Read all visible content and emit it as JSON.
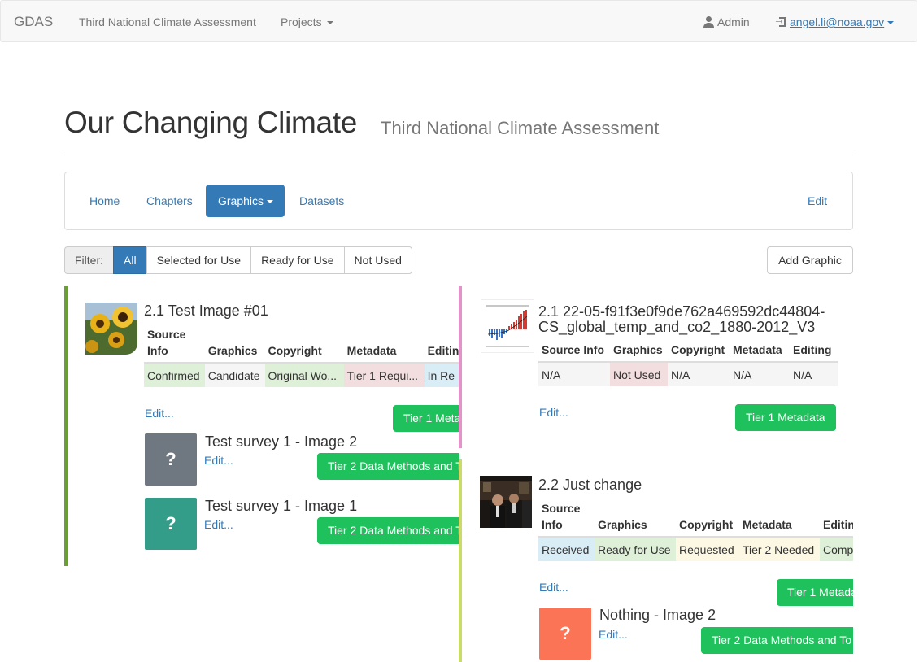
{
  "navbar": {
    "brand": "GDAS",
    "assessment": "Third National Climate Assessment",
    "projects": "Projects",
    "admin": "Admin",
    "user": "angel.li@noaa.gov"
  },
  "header": {
    "title": "Our Changing Climate",
    "subtitle": "Third National Climate Assessment"
  },
  "tabs": {
    "home": "Home",
    "chapters": "Chapters",
    "graphics": "Graphics",
    "datasets": "Datasets",
    "edit": "Edit"
  },
  "filter": {
    "label": "Filter:",
    "all": "All",
    "selected": "Selected for Use",
    "ready": "Ready for Use",
    "not_used": "Not Used",
    "add": "Add Graphic"
  },
  "columns": {
    "source_info": "Source Info",
    "graphics": "Graphics",
    "copyright": "Copyright",
    "metadata": "Metadata",
    "editing": "Editing"
  },
  "cards": [
    {
      "title": "2.1 Test Image #01",
      "values": [
        "Confirmed",
        "Candidate",
        "Original Wo...",
        "Tier 1 Requi...",
        "In Re"
      ],
      "edit": "Edit...",
      "button": "Tier 1 Meta",
      "bar_color": "#6b9e34",
      "children": [
        {
          "title": "Test survey 1 - Image 2",
          "edit": "Edit...",
          "button": "Tier 2 Data Methods and T",
          "q": "?",
          "color": "#6f7780"
        },
        {
          "title": "Test survey 1 - Image 1",
          "edit": "Edit...",
          "button": "Tier 2 Data Methods and T",
          "q": "?",
          "color": "#339d8a"
        }
      ]
    },
    {
      "title_line1": "2.1 22-05-f91f3e0f9de762a469592dc44804-",
      "title_line2": "CS_global_temp_and_co2_1880-2012_V3",
      "values": [
        "N/A",
        "Not Used",
        "N/A",
        "N/A",
        "N/A"
      ],
      "edit": "Edit...",
      "button": "Tier 1 Metadata",
      "bar_color": "#e293c8"
    },
    {
      "title": "2.2 Just change",
      "values": [
        "Received",
        "Ready for Use",
        "Requested",
        "Tier 2 Needed",
        "Comp"
      ],
      "edit": "Edit...",
      "button": "Tier 1 Metada",
      "bar_color": "#c9dc6a",
      "children": [
        {
          "title": "Nothing - Image 2",
          "edit": "Edit...",
          "button": "Tier 2 Data Methods and To",
          "q": "?",
          "color": "#fb7455"
        }
      ]
    }
  ]
}
